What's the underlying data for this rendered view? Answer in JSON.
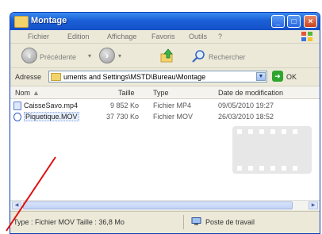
{
  "window": {
    "title": "Montage"
  },
  "menu": [
    "Fichier",
    "Edition",
    "Affichage",
    "Favoris",
    "Outils",
    "?"
  ],
  "toolbar": {
    "back_label": "Précédente",
    "search_label": "Rechercher"
  },
  "address": {
    "label": "Adresse",
    "value": "uments and Settings\\MSTD\\Bureau\\Montage",
    "go_label": "OK"
  },
  "columns": [
    "Nom",
    "Taille",
    "Type",
    "Date de modification"
  ],
  "files": [
    {
      "name": "CaisseSavo.mp4",
      "size": "9 852 Ko",
      "type": "Fichier MP4",
      "date": "09/05/2010 19:27"
    },
    {
      "name": "Piquetique.MOV",
      "size": "37 730 Ko",
      "type": "Fichier MOV",
      "date": "26/03/2010 18:52"
    }
  ],
  "status": {
    "left": "Type : Fichier MOV Taille : 36,8 Mo",
    "right": "Poste de travail"
  },
  "colors": {
    "titlebar": "#1a5fd6",
    "annotation": "#e01010",
    "window_bg": "#ece9d8"
  }
}
